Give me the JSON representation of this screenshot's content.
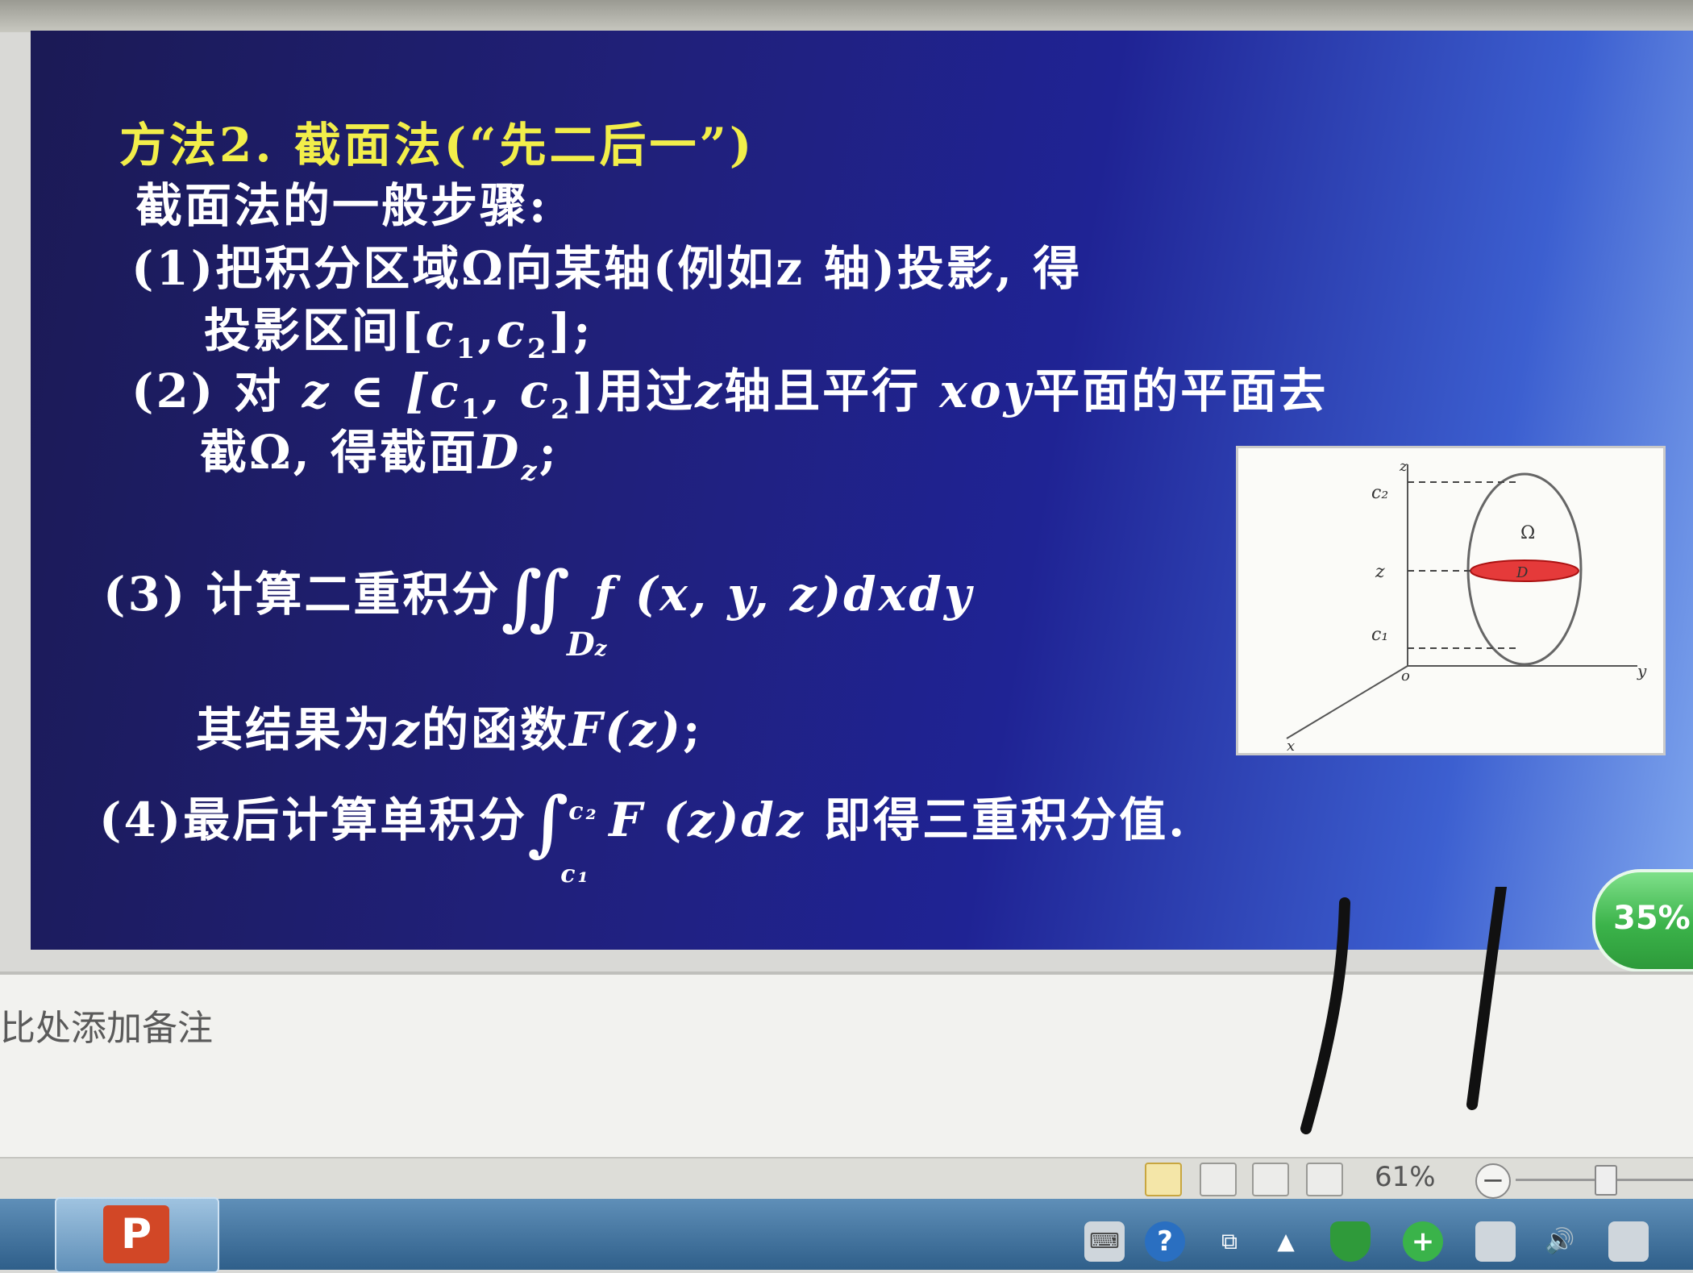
{
  "slide": {
    "title": "方法2. 截面法(“先二后一”)",
    "steps_heading": "截面法的一般步骤:",
    "step1_a": "(1)把积分区域Ω向某轴(例如z  轴)投影, 得",
    "step1_b_prefix": "投影区间[",
    "step1_b_c1": "c",
    "step1_b_c2": "c",
    "step1_b_suffix": "];",
    "sub1": "1",
    "sub2": "2",
    "step2_a_1": "(2) 对 ",
    "step2_a_2": "z ∈ [c",
    "step2_a_3": ", c",
    "step2_a_4": "]",
    "step2_a_5": "用过",
    "step2_a_6": "z",
    "step2_a_7": "轴且平行 ",
    "step2_a_8": "xoy",
    "step2_a_9": "平面的平面去",
    "step2_b_1": "截Ω, 得截面",
    "step2_b_2": "D",
    "step2_b_sub": "z",
    "step2_b_3": ";",
    "step3_1": "(3) 计算二重积分",
    "step3_int": "∬",
    "step3_expr": "f (x, y, z)dxdy",
    "step3_under": "D",
    "step3_under_sub": "z",
    "step3b_1": "其结果为",
    "step3b_2": "z",
    "step3b_3": "的函数",
    "step3b_4": "F(z)",
    "step3b_5": ";",
    "step4_1": "(4)最后计算单积分",
    "step4_int": "∫",
    "step4_upper": "c₂",
    "step4_lower": "c₁",
    "step4_expr": "F (z)dz",
    "step4_2": " 即得三重积分值."
  },
  "figure": {
    "label_z_axis": "z",
    "label_c2": "c₂",
    "label_z": "z",
    "label_c1": "c₁",
    "label_omega": "Ω",
    "label_D": "D",
    "label_o": "o",
    "label_x": "x",
    "label_y": "y",
    "section_color": "#e53a3a"
  },
  "badge": {
    "text": "35%"
  },
  "notes": {
    "placeholder": "比处添加备注"
  },
  "statusbar": {
    "zoom": "61%",
    "minus": "−"
  },
  "taskbar": {
    "ppt_label": "P"
  },
  "tray": {
    "help": "?",
    "plus": "+"
  }
}
